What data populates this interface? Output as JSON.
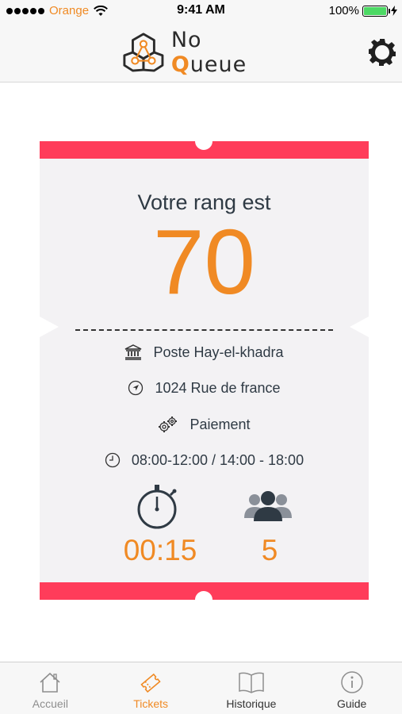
{
  "status_bar": {
    "carrier": "Orange",
    "time": "9:41 AM",
    "battery": "100%"
  },
  "header": {
    "logo_text_no": "No",
    "logo_text_q": "Q",
    "logo_text_rest": "ueue",
    "logo_icon": "hexagon-network-logo",
    "settings_icon": "gear-icon"
  },
  "ticket": {
    "rank_label": "Votre rang est",
    "rank_value": "70",
    "location": "Poste Hay-el-khadra",
    "address": "1024 Rue de france",
    "service": "Paiement",
    "hours": "08:00-12:00 / 14:00 - 18:00",
    "wait_time": "00:15",
    "people_ahead": "5"
  },
  "tabs": [
    {
      "label": "Accueil",
      "icon": "home-icon",
      "active": false
    },
    {
      "label": "Tickets",
      "icon": "ticket-icon",
      "active": true
    },
    {
      "label": "Historique",
      "icon": "book-icon",
      "active": false
    },
    {
      "label": "Guide",
      "icon": "info-icon",
      "active": false
    }
  ],
  "colors": {
    "accent": "#f08a24",
    "ticket_band": "#ff3c5a",
    "ticket_body": "#f3f2f4",
    "text": "#2f3a44"
  }
}
